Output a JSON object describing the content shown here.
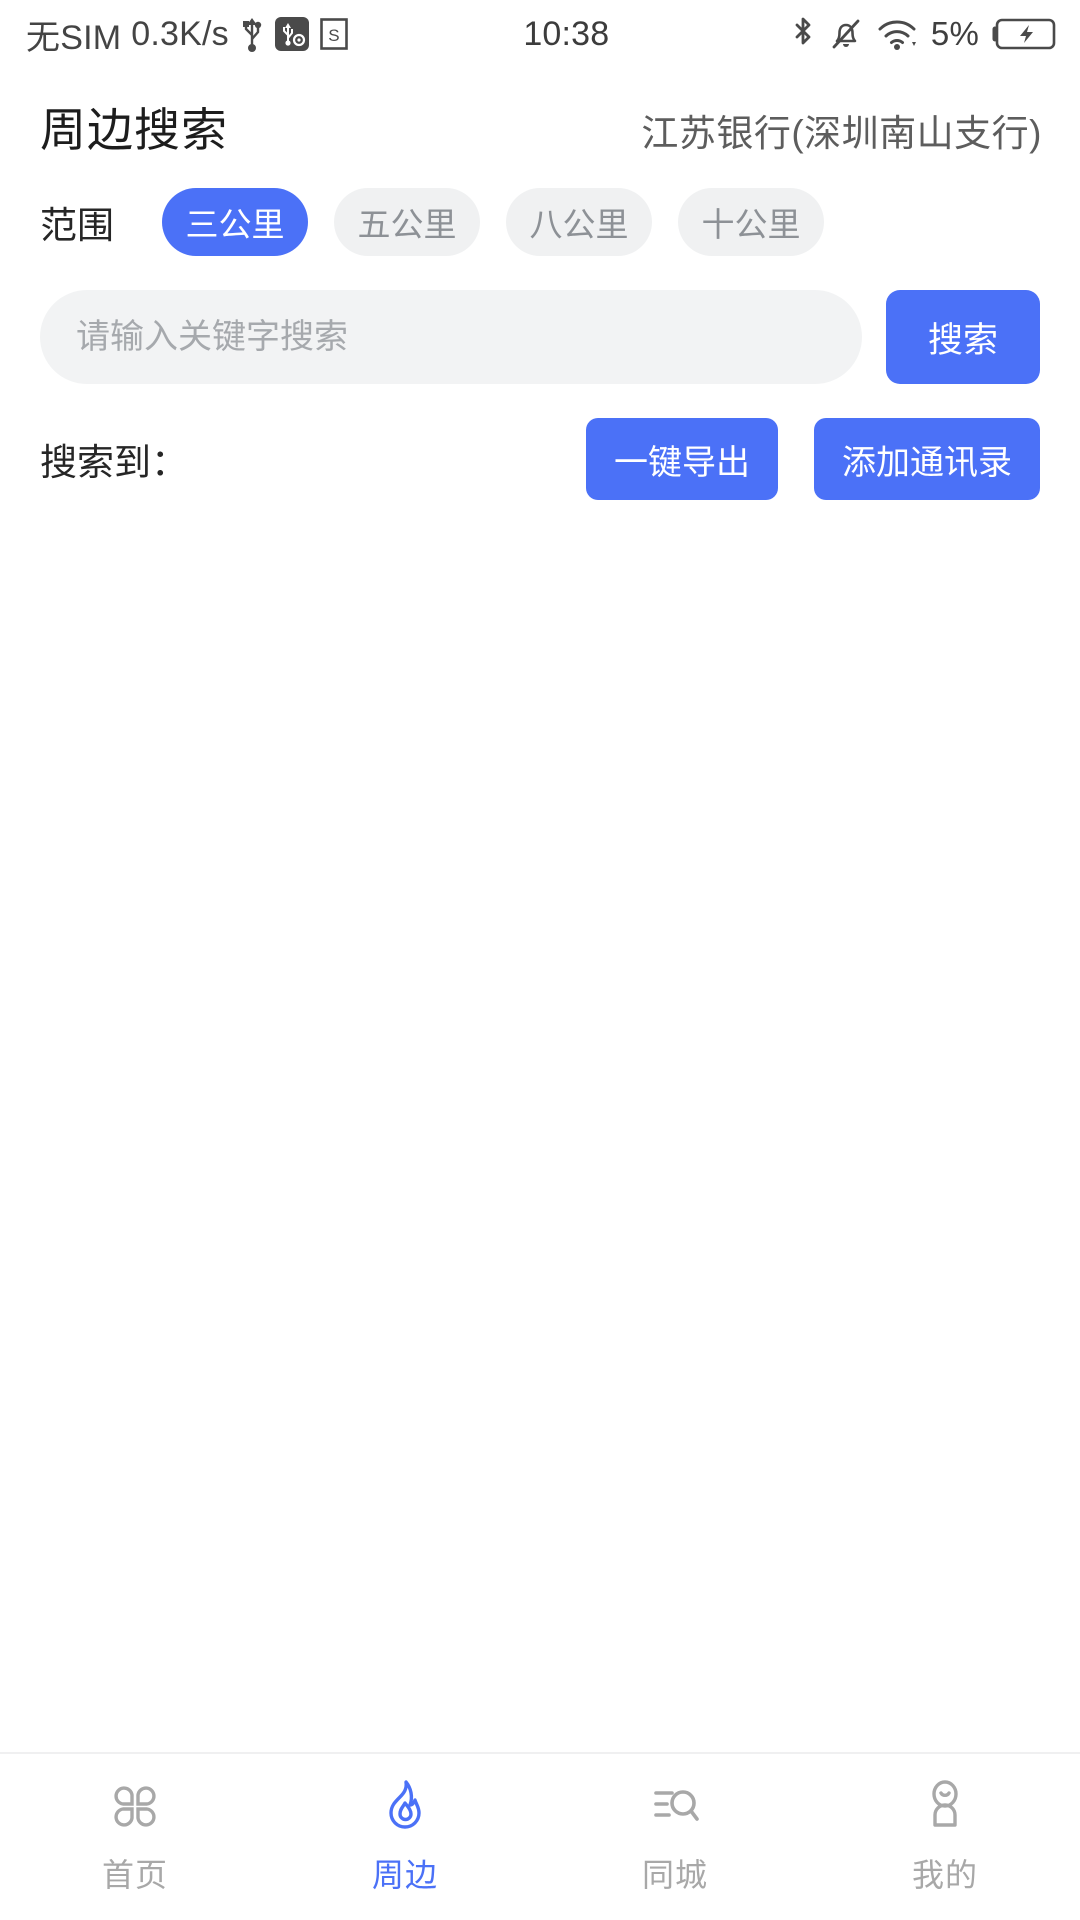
{
  "statusbar": {
    "carrier": "无SIM",
    "network_speed": "0.3K/s",
    "icons_left": [
      "usb-icon",
      "usb-debug-icon",
      "screenshot-icon"
    ],
    "time": "10:38",
    "icons_right": [
      "bluetooth-icon",
      "mute-bell-icon",
      "wifi-icon"
    ],
    "battery_percent": "5%",
    "battery_state": "charging"
  },
  "header": {
    "title": "周边搜索",
    "branch": "江苏银行(深圳南山支行)"
  },
  "range": {
    "label": "范围",
    "options": [
      {
        "label": "三公里",
        "selected": true
      },
      {
        "label": "五公里",
        "selected": false
      },
      {
        "label": "八公里",
        "selected": false
      },
      {
        "label": "十公里",
        "selected": false
      }
    ]
  },
  "search": {
    "placeholder": "请输入关键字搜索",
    "value": "",
    "button_label": "搜索"
  },
  "actions": {
    "found_label": "搜索到：",
    "export_label": "一键导出",
    "add_contacts_label": "添加通讯录"
  },
  "results": {
    "items": []
  },
  "tabbar": {
    "items": [
      {
        "label": "首页",
        "icon": "grid-clover-icon",
        "active": false
      },
      {
        "label": "周边",
        "icon": "flame-icon",
        "active": true
      },
      {
        "label": "同城",
        "icon": "list-search-icon",
        "active": false
      },
      {
        "label": "我的",
        "icon": "person-icon",
        "active": false
      }
    ]
  },
  "colors": {
    "accent": "#4b71f7",
    "pill_inactive_bg": "#f0f1f2",
    "pill_inactive_text": "#8d9196",
    "search_bg": "#f2f3f4",
    "placeholder": "#a6a9ad",
    "tab_inactive": "#a8a8a8",
    "title": "#1d1d1d",
    "branch": "#5d5d5d"
  }
}
